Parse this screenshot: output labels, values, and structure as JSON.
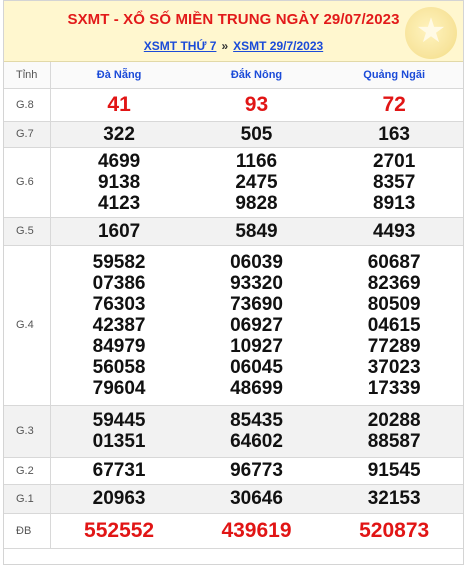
{
  "header": {
    "title": "SXMT - XỔ SỐ MIỀN TRUNG NGÀY 29/07/2023",
    "nav": [
      "XSMT THỨ 7",
      "XSMT 29/7/2023"
    ],
    "separator": "»"
  },
  "columns": {
    "label": "Tỉnh",
    "provinces": [
      "Đà Nẵng",
      "Đắk Nông",
      "Quảng Ngãi"
    ]
  },
  "prizes": [
    {
      "label": "G.8",
      "values": [
        [
          "41"
        ],
        [
          "93"
        ],
        [
          "72"
        ]
      ]
    },
    {
      "label": "G.7",
      "values": [
        [
          "322"
        ],
        [
          "505"
        ],
        [
          "163"
        ]
      ]
    },
    {
      "label": "G.6",
      "values": [
        [
          "4699",
          "9138",
          "4123"
        ],
        [
          "1166",
          "2475",
          "9828"
        ],
        [
          "2701",
          "8357",
          "8913"
        ]
      ]
    },
    {
      "label": "G.5",
      "values": [
        [
          "1607"
        ],
        [
          "5849"
        ],
        [
          "4493"
        ]
      ]
    },
    {
      "label": "G.4",
      "values": [
        [
          "59582",
          "07386",
          "76303",
          "42387",
          "84979",
          "56058",
          "79604"
        ],
        [
          "06039",
          "93320",
          "73690",
          "06927",
          "10927",
          "06045",
          "48699"
        ],
        [
          "60687",
          "82369",
          "80509",
          "04615",
          "77289",
          "37023",
          "17339"
        ]
      ]
    },
    {
      "label": "G.3",
      "values": [
        [
          "59445",
          "01351"
        ],
        [
          "85435",
          "64602"
        ],
        [
          "20288",
          "88587"
        ]
      ]
    },
    {
      "label": "G.2",
      "values": [
        [
          "67731"
        ],
        [
          "96773"
        ],
        [
          "91545"
        ]
      ]
    },
    {
      "label": "G.1",
      "values": [
        [
          "20963"
        ],
        [
          "30646"
        ],
        [
          "32153"
        ]
      ]
    },
    {
      "label": "ĐB",
      "values": [
        [
          "552552"
        ],
        [
          "439619"
        ],
        [
          "520873"
        ]
      ]
    }
  ],
  "colors": {
    "accent_red": "#e11515",
    "link_blue": "#1b4bd8",
    "header_bg": "#fff7cf"
  }
}
